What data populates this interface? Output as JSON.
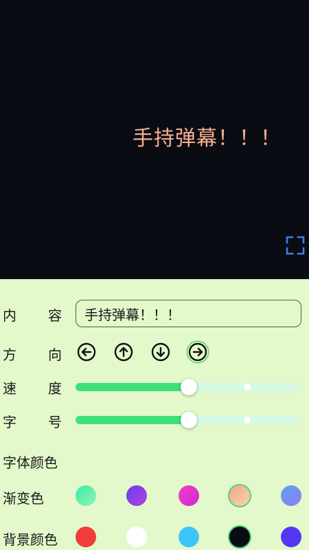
{
  "preview": {
    "text": "手持弹幕！！！",
    "text_color": "#f5b08e",
    "background": "#0a0c14",
    "fullscreen_icon": "fullscreen-icon"
  },
  "content": {
    "label_a": "内",
    "label_b": "容",
    "value": "手持弹幕！！！"
  },
  "direction": {
    "label_a": "方",
    "label_b": "向",
    "options": [
      {
        "icon": "arrow-left-icon"
      },
      {
        "icon": "arrow-up-icon"
      },
      {
        "icon": "arrow-down-icon"
      },
      {
        "icon": "arrow-right-icon",
        "selected": true
      }
    ]
  },
  "speed": {
    "label_a": "速",
    "label_b": "度",
    "value": 0.5
  },
  "font_size": {
    "label_a": "字",
    "label_b": "号",
    "value": 0.5
  },
  "font_color": {
    "label": "字体颜色"
  },
  "gradient": {
    "label": "渐变色",
    "swatches": [
      {
        "from": "#3ee7a4",
        "to": "#8df7b6"
      },
      {
        "from": "#6a3cf0",
        "to": "#b243e0"
      },
      {
        "from": "#f23cc6",
        "to": "#d12ad4"
      },
      {
        "from": "#f5a58a",
        "to": "#f8d0b0",
        "selected": true
      },
      {
        "from": "#5fa0f5",
        "to": "#8f7df2"
      }
    ]
  },
  "background_color": {
    "label": "背景颜色",
    "swatches": [
      {
        "color": "#f23b3b"
      },
      {
        "color": "#ffffff"
      },
      {
        "color": "#3cc5f7"
      },
      {
        "color": "#0a0c14",
        "selected": true
      },
      {
        "color": "#5536f2"
      }
    ]
  }
}
